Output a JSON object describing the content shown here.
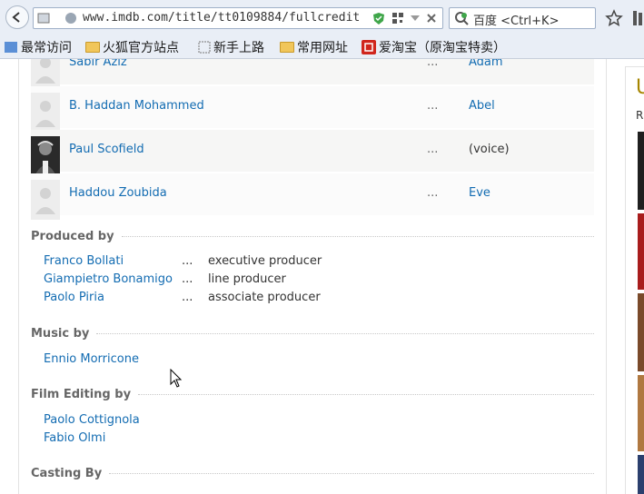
{
  "browser": {
    "url": "www.imdb.com/title/tt0109884/fullcredit",
    "search_placeholder": "百度 <Ctrl+K>"
  },
  "bookmarks": [
    {
      "label": "最常访问"
    },
    {
      "label": "火狐官方站点"
    },
    {
      "label": "新手上路"
    },
    {
      "label": "常用网址"
    },
    {
      "label": "爱淘宝（原淘宝特卖）"
    }
  ],
  "cast": [
    {
      "name": "Sabir Aziz",
      "dots": "...",
      "character": "Adam"
    },
    {
      "name": "B. Haddan Mohammed",
      "dots": "...",
      "character": "Abel"
    },
    {
      "name": "Paul Scofield",
      "dots": "...",
      "character": "(voice)"
    },
    {
      "name": "Haddou Zoubida",
      "dots": "...",
      "character": "Eve"
    }
  ],
  "produced_by": {
    "heading": "Produced by",
    "rows": [
      {
        "name": "Franco Bollati",
        "dots": "...",
        "credit": "executive producer"
      },
      {
        "name": "Giampietro Bonamigo",
        "dots": "...",
        "credit": "line producer"
      },
      {
        "name": "Paolo Piria",
        "dots": "...",
        "credit": "associate producer"
      }
    ]
  },
  "music_by": {
    "heading": "Music by",
    "rows": [
      {
        "name": "Ennio Morricone"
      }
    ]
  },
  "film_editing_by": {
    "heading": "Film Editing by",
    "rows": [
      {
        "name": "Paolo Cottignola"
      },
      {
        "name": "Fabio Olmi"
      }
    ]
  },
  "casting_by": {
    "heading": "Casting By"
  },
  "sidebar": {
    "letter": "U",
    "letter2": "R"
  },
  "colors": {
    "link": "#136cb2",
    "heading": "#666666",
    "sidebar_accent": "#a58500"
  }
}
